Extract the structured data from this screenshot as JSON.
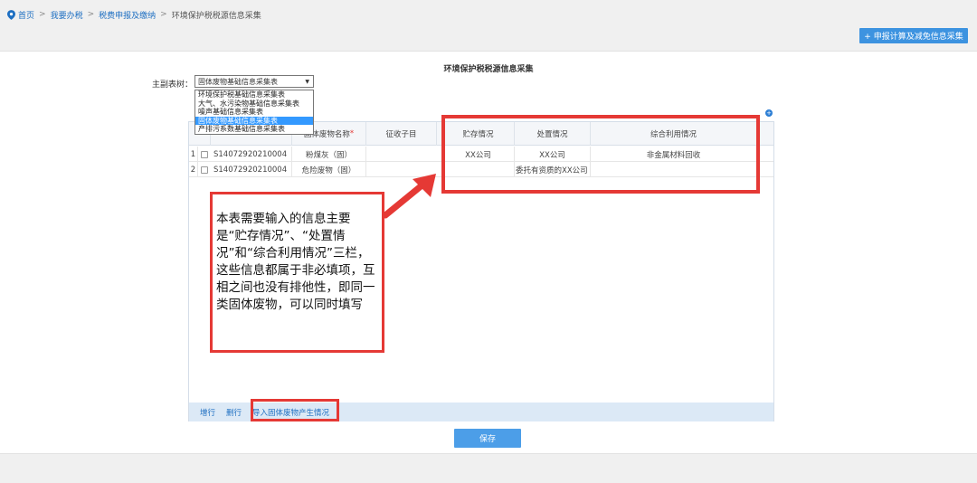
{
  "breadcrumb": {
    "items": [
      "首页",
      "我要办税",
      "税费申报及缴纳"
    ],
    "current": "环境保护税税源信息采集",
    "separator": ">"
  },
  "top_button": {
    "label": "+ 申报计算及减免信息采集"
  },
  "panel": {
    "title": "环境保护税税源信息采集"
  },
  "form": {
    "main_sub_label": "主副表树：",
    "selected": "固体废物基础信息采集表",
    "options": [
      "环境保护税基础信息采集表",
      "大气、水污染物基础信息采集表",
      "噪声基础信息采集表",
      "固体废物基础信息采集表",
      "产排污系数基础信息采集表"
    ],
    "selected_index": 3
  },
  "table": {
    "headers": {
      "col_code_partial": "",
      "col_name": "固体废物名称",
      "col_name_required": "*",
      "col_subitem": "征收子目",
      "col_storage": "贮存情况",
      "col_disposal": "处置情况",
      "col_utilization": "综合利用情况"
    },
    "rows": [
      {
        "num": "1",
        "code": "S14072920210004",
        "name": "粉煤灰（固）",
        "subitem": "",
        "storage": "XX公司",
        "disposal": "XX公司",
        "utilization": "非金属材料回收"
      },
      {
        "num": "2",
        "code": "S14072920210004",
        "name": "危险废物（固）",
        "subitem": "",
        "storage": "",
        "disposal": "委托有资质的XX公司",
        "utilization": ""
      }
    ]
  },
  "bottom_bar": {
    "add_row": "增行",
    "delete_row": "删行",
    "import": "导入固体废物产生情况"
  },
  "save_label": "保存",
  "annotation": {
    "text": "本表需要输入的信息主要是“贮存情况”、“处置情况”和“综合利用情况”三栏，这些信息都属于非必填项，互相之间也没有排他性，即同一类固体废物，可以同时填写"
  },
  "colors": {
    "accent": "#3d93e0",
    "link": "#1e6fc2",
    "highlight_red": "#e53935",
    "selected_option": "#3399ff"
  }
}
